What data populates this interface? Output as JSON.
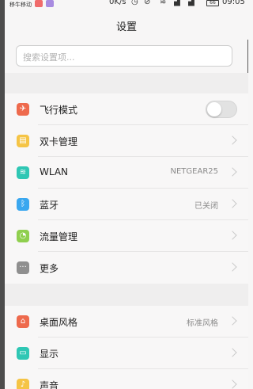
{
  "statusbar": {
    "carrier": "移牛移动",
    "speed": "0K/s",
    "time": "09:05",
    "battery": "66"
  },
  "header": {
    "title": "设置"
  },
  "search": {
    "placeholder": "搜索设置项..."
  },
  "colors": {
    "airplane": "#ee6a4d",
    "dualsim": "#f5c445",
    "wlan": "#2fc7b4",
    "bluetooth": "#3aa7ef",
    "data": "#8fcf4e",
    "more": "#8f8f8f",
    "theme": "#ee6a4d",
    "display": "#2fc7b4",
    "sound": "#f5c445"
  },
  "group1": {
    "airplane": {
      "label": "飞行模式",
      "icon": "airplane-icon",
      "toggle_on": false
    },
    "dualsim": {
      "label": "双卡管理",
      "icon": "sim-card-icon"
    },
    "wlan": {
      "label": "WLAN",
      "icon": "wifi-icon",
      "value": "NETGEAR25"
    },
    "bluetooth": {
      "label": "蓝牙",
      "icon": "bluetooth-icon",
      "value": "已关闭"
    },
    "data": {
      "label": "流量管理",
      "icon": "gauge-icon"
    },
    "more": {
      "label": "更多",
      "icon": "more-dots-icon"
    }
  },
  "group2": {
    "theme": {
      "label": "桌面风格",
      "icon": "home-icon",
      "value": "标准风格"
    },
    "display": {
      "label": "显示",
      "icon": "display-icon"
    },
    "sound": {
      "label": "声音",
      "icon": "speaker-icon"
    }
  }
}
